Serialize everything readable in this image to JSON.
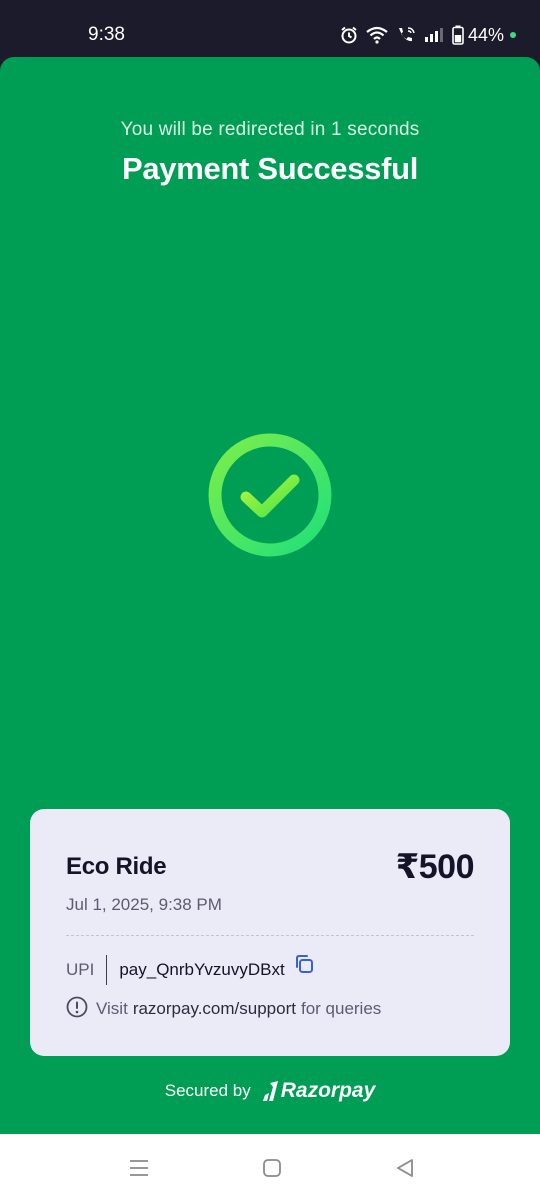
{
  "status_bar": {
    "time": "9:38",
    "battery": "44%",
    "icons": [
      "alarm-icon",
      "wifi-icon",
      "wifi-calling-icon",
      "signal-icon",
      "battery-icon"
    ]
  },
  "header": {
    "redirect_text": "You will be redirected in 1 seconds",
    "title": "Payment Successful"
  },
  "status_icon": "check-circle-icon",
  "card": {
    "merchant": "Eco Ride",
    "amount": "₹500",
    "datetime": "Jul 1, 2025, 9:38 PM",
    "method": "UPI",
    "payment_id": "pay_QnrbYvzuvyDBxt",
    "support_prefix": "Visit",
    "support_link": "razorpay.com/support",
    "support_suffix": "for queries"
  },
  "footer": {
    "secured_by": "Secured by",
    "brand": "Razorpay"
  },
  "nav": {
    "icons": [
      "menu-icon",
      "home-icon",
      "back-icon"
    ]
  },
  "colors": {
    "primary_green": "#009d55",
    "card_bg": "#ebeaf7",
    "success_ring": "#3ee35a",
    "link_blue": "#3a5fd6"
  }
}
